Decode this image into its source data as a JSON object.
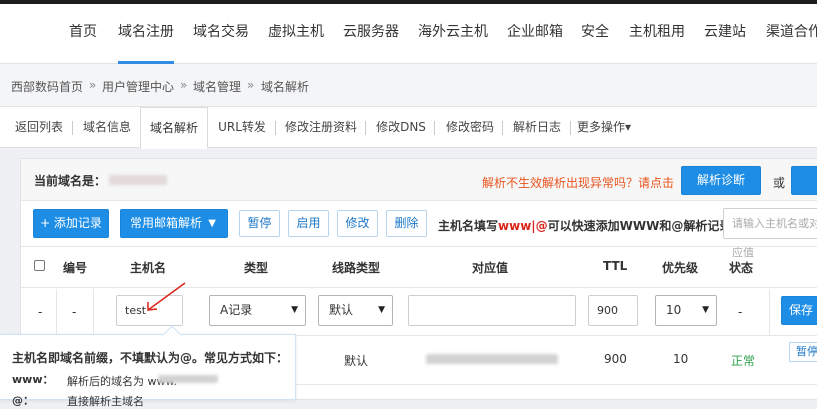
{
  "nav": {
    "items": [
      "首页",
      "域名注册",
      "域名交易",
      "虚拟主机",
      "云服务器",
      "海外云主机",
      "企业邮箱",
      "安全",
      "主机租用",
      "云建站",
      "渠道合作"
    ]
  },
  "breadcrumb": {
    "items": [
      "西部数码首页",
      "用户管理中心",
      "域名管理",
      "域名解析"
    ],
    "separator": "»"
  },
  "tabs": {
    "items": [
      "返回列表",
      "域名信息",
      "域名解析",
      "URL转发",
      "修改注册资料",
      "修改DNS",
      "修改密码",
      "解析日志",
      "更多操作"
    ],
    "more_caret": "▾"
  },
  "domain_bar": {
    "label": "当前域名是：",
    "notice": "解析不生效解析出现异常吗？请点击",
    "diagnose_button": "解析诊断",
    "or": "或"
  },
  "toolbar": {
    "add_record": "+ 添加记录",
    "mail_resolve": "常用邮箱解析",
    "mail_caret": "▼",
    "pause": "暂停",
    "enable": "启用",
    "modify": "修改",
    "delete": "删除",
    "hint_prefix": "主机名填写",
    "hint_highlight": "www|@",
    "hint_suffix": "可以快速添加WWW和@解析记录",
    "search_placeholder": "请输入主机名或对应值"
  },
  "table": {
    "headers": [
      "编号",
      "主机名",
      "类型",
      "线路类型",
      "对应值",
      "TTL",
      "优先级",
      "状态"
    ],
    "edit_row": {
      "col0": "-",
      "col1": "-",
      "host": "test",
      "type": "A记录",
      "line": "默认",
      "ttl": "900",
      "priority": "10",
      "status": "-",
      "save": "保存"
    },
    "row2": {
      "line": "默认",
      "ttl": "900",
      "priority": "10",
      "status": "正常",
      "action": "暂停"
    }
  },
  "tooltip": {
    "title": "主机名即域名前缀，不填默认为@。常见方式如下：",
    "line1_key": "www：",
    "line1_value": "解析后的域名为 www.",
    "line2_key": "@：",
    "line2_value": "直接解析主域名"
  },
  "colors": {
    "accent": "#1d8de5",
    "warning": "#e8541e",
    "highlight": "#d9251c",
    "status_ok": "#2ea14a",
    "annotation_arrow": "#d9251c"
  }
}
